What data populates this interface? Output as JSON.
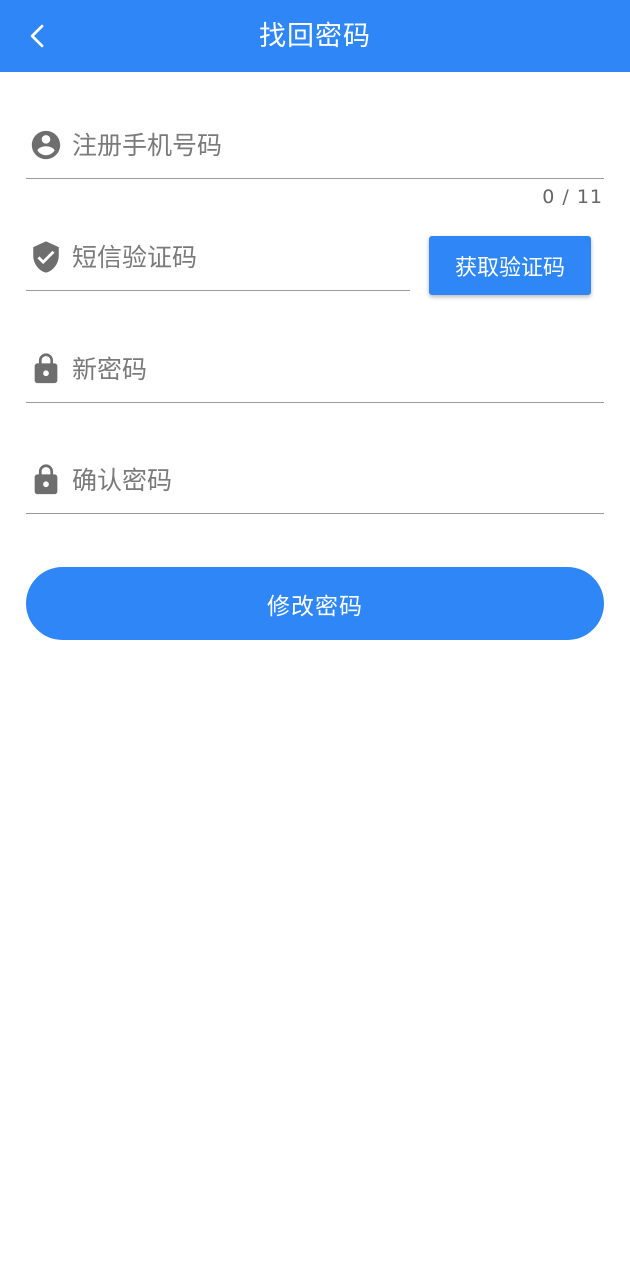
{
  "header": {
    "title": "找回密码",
    "back_icon": "chevron-left-icon"
  },
  "form": {
    "phone": {
      "placeholder": "注册手机号码",
      "value": "",
      "counter": "0 / 11",
      "icon": "account-circle-icon"
    },
    "sms_code": {
      "placeholder": "短信验证码",
      "value": "",
      "icon": "shield-check-icon",
      "button_label": "获取验证码"
    },
    "new_password": {
      "placeholder": "新密码",
      "value": "",
      "icon": "lock-icon"
    },
    "confirm_password": {
      "placeholder": "确认密码",
      "value": "",
      "icon": "lock-icon"
    },
    "submit_label": "修改密码"
  },
  "colors": {
    "accent": "#2f87f7",
    "icon": "#6e6e6e",
    "divider": "#9a9a9a"
  }
}
